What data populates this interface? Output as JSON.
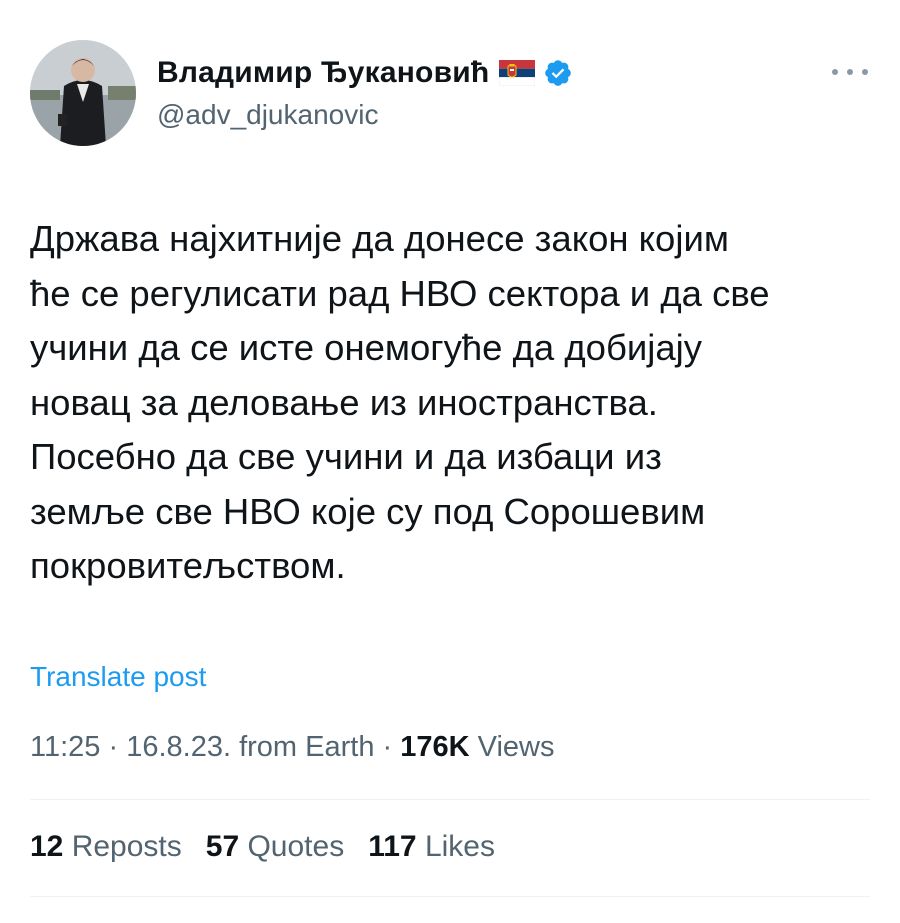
{
  "author": {
    "display_name": "Владимир Ђукановић",
    "handle": "@adv_djukanovic",
    "flag_icon": "serbia-flag-icon",
    "verified_icon": "verified-badge-icon",
    "verified_color": "#1d9bf0"
  },
  "menu_icon": "more-options-icon",
  "tweet": {
    "lines": [
      "Држава најхитније да донесе закон којим",
      "ће се регулисати рад НВО сектора и да све",
      "учини да се исте онемогуће да добијају",
      "новац за деловање из иностранства.",
      "Посебно да све учини и да избаци из",
      "земље све НВО које су под Сорошевим",
      "покровитељством."
    ]
  },
  "translate_label": "Translate post",
  "meta": {
    "time": "11:25",
    "sep1": " · ",
    "date": "16.8.23.",
    "source": " from Earth",
    "sep2": " · ",
    "views_count": "176K",
    "views_label": " Views"
  },
  "stats": [
    {
      "count": "12",
      "label": " Reposts"
    },
    {
      "count": "57",
      "label": " Quotes"
    },
    {
      "count": "117",
      "label": " Likes"
    }
  ],
  "colors": {
    "text": "#0f1419",
    "secondary": "#536471",
    "link": "#1d9bf0",
    "divider": "#eff3f4"
  }
}
